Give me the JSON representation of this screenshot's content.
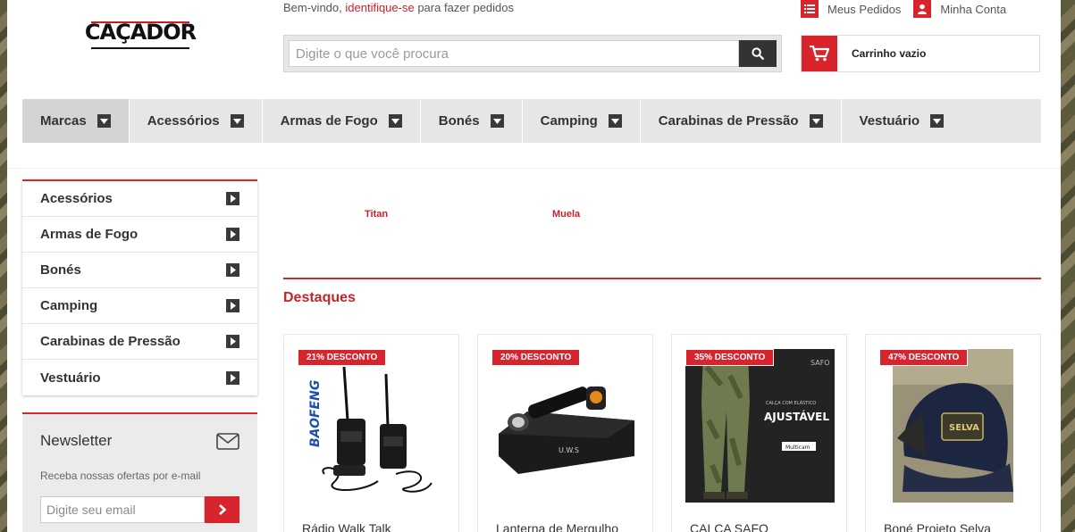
{
  "header": {
    "logo_text": "CAÇADOR",
    "welcome_prefix": "Bem-vindo,",
    "welcome_link": "identifique-se",
    "welcome_suffix": "para fazer pedidos",
    "search_placeholder": "Digite o que você procura",
    "my_orders": "Meus Pedidos",
    "my_account": "Minha Conta",
    "cart_label": "Carrinho vazio"
  },
  "nav": {
    "items": [
      "Marcas",
      "Acessórios",
      "Armas de Fogo",
      "Bonés",
      "Camping",
      "Carabinas de Pressão",
      "Vestuário"
    ]
  },
  "sidebar": {
    "items": [
      "Acessórios",
      "Armas de Fogo",
      "Bonés",
      "Camping",
      "Carabinas de Pressão",
      "Vestuário"
    ]
  },
  "newsletter": {
    "title": "Newsletter",
    "description": "Receba nossas ofertas por e-mail",
    "placeholder": "Digite seu email"
  },
  "brands": [
    "Titan",
    "Muela"
  ],
  "featured": {
    "title": "Destaques",
    "products": [
      {
        "badge": "21% DESCONTO",
        "name": "Rádio Walk Talk"
      },
      {
        "badge": "20% DESCONTO",
        "name": "Lanterna de Mergulho"
      },
      {
        "badge": "35% DESCONTO",
        "name": "CALÇA SAFO"
      },
      {
        "badge": "47% DESCONTO",
        "name": "Boné Projeto Selva"
      }
    ],
    "product_image_text": {
      "radio_brand": "BAOFENG",
      "flashlight_box": "U.W.S",
      "pants_caption": "CALÇA COM ELÁSTICO",
      "pants_title": "AJUSTÁVEL",
      "pants_brand": "SAFO",
      "pants_tag": "Multicam",
      "cap_patch": "SELVA"
    }
  },
  "colors": {
    "accent_red": "#d8242c",
    "nav_bg": "#e6e6e6",
    "dark_box": "#3a3a3a"
  }
}
